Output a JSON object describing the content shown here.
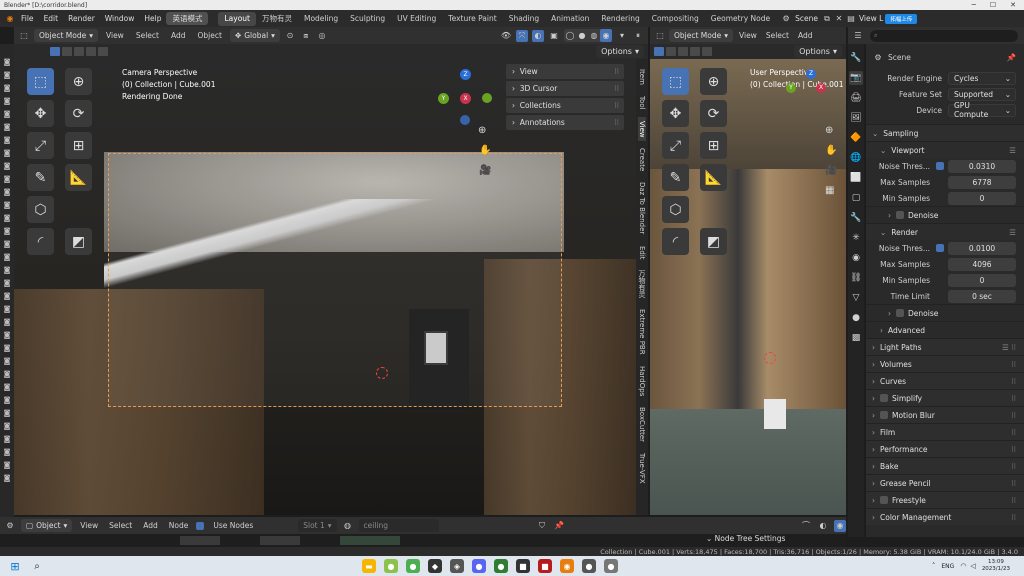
{
  "window": {
    "title": "Blender* [D:\\corridor.blend]"
  },
  "menu": {
    "items": [
      "File",
      "Edit",
      "Render",
      "Window",
      "Help"
    ],
    "extra_button": "英语模式"
  },
  "workspaces": {
    "tabs": [
      "Layout",
      "万物有灵",
      "Modeling",
      "Sculpting",
      "UV Editing",
      "Texture Paint",
      "Shading",
      "Animation",
      "Rendering",
      "Compositing",
      "Geometry Node"
    ],
    "active": "Layout"
  },
  "scene": {
    "label": "Scene",
    "view_layer": "View L",
    "upload_badge": "拓幅上传"
  },
  "left_viewport": {
    "mode": "Object Mode",
    "menus": [
      "View",
      "Select",
      "Add",
      "Object"
    ],
    "transform": "Global",
    "options": "Options",
    "overlay_text": [
      "Camera Perspective",
      "(0) Collection | Cube.001",
      "Rendering Done"
    ],
    "npanel_items": [
      "View",
      "3D Cursor",
      "Collections",
      "Annotations"
    ],
    "npanel_tabs": [
      "Item",
      "Tool",
      "View",
      "Create",
      "Daz To Blender",
      "Edit",
      "万物有灵",
      "Extreme PBR",
      "HardOps",
      "BoxCutter",
      "True-VFX"
    ],
    "npanel_active_tab": "View",
    "gizmo_axes": {
      "z": "Z",
      "y": "Y",
      "x": "X"
    }
  },
  "right_viewport": {
    "mode": "Object Mode",
    "menus": [
      "View",
      "Select",
      "Add"
    ],
    "options": "Options",
    "overlay_text": [
      "User Perspective",
      "(0) Collection | Cube.001"
    ],
    "gizmo_axes": {
      "z": "Z",
      "y": "Y",
      "x": "X"
    }
  },
  "properties": {
    "search_placeholder": "",
    "title": "Scene",
    "render_engine": {
      "label": "Render Engine",
      "value": "Cycles"
    },
    "feature_set": {
      "label": "Feature Set",
      "value": "Supported"
    },
    "device": {
      "label": "Device",
      "value": "GPU Compute"
    },
    "sampling": "Sampling",
    "viewport": {
      "header": "Viewport",
      "noise_label": "Noise Thres...",
      "noise": "0.0310",
      "max_label": "Max Samples",
      "max": "6778",
      "min_label": "Min Samples",
      "min": "0",
      "denoise": "Denoise"
    },
    "render": {
      "header": "Render",
      "noise_label": "Noise Thres...",
      "noise": "0.0100",
      "max_label": "Max Samples",
      "max": "4096",
      "min_label": "Min Samples",
      "min": "0",
      "time_label": "Time Limit",
      "time": "0 sec",
      "denoise": "Denoise"
    },
    "advanced": "Advanced",
    "panels": [
      "Light Paths",
      "Volumes",
      "Curves",
      "Simplify",
      "Motion Blur",
      "Film",
      "Performance",
      "Bake",
      "Grease Pencil",
      "Freestyle",
      "Color Management"
    ],
    "panels_with_checkbox": [
      "Simplify",
      "Motion Blur",
      "Freestyle"
    ]
  },
  "node_editor": {
    "type": "Object",
    "menus": [
      "View",
      "Select",
      "Add",
      "Node"
    ],
    "use_nodes": "Use Nodes",
    "slot": "Slot 1",
    "material": "ceiling",
    "tree_settings": "Node Tree Settings"
  },
  "status_bar": {
    "text": "Collection | Cube.001 | Verts:18,475 | Faces:18,700 | Tris:36,716 | Objects:1/26 | Memory: 5.38 GiB | VRAM: 10.1/24.0 GiB | 3.4.0"
  },
  "taskbar": {
    "lang": "ENG",
    "time": "13:09",
    "date": "2023/1/23"
  }
}
